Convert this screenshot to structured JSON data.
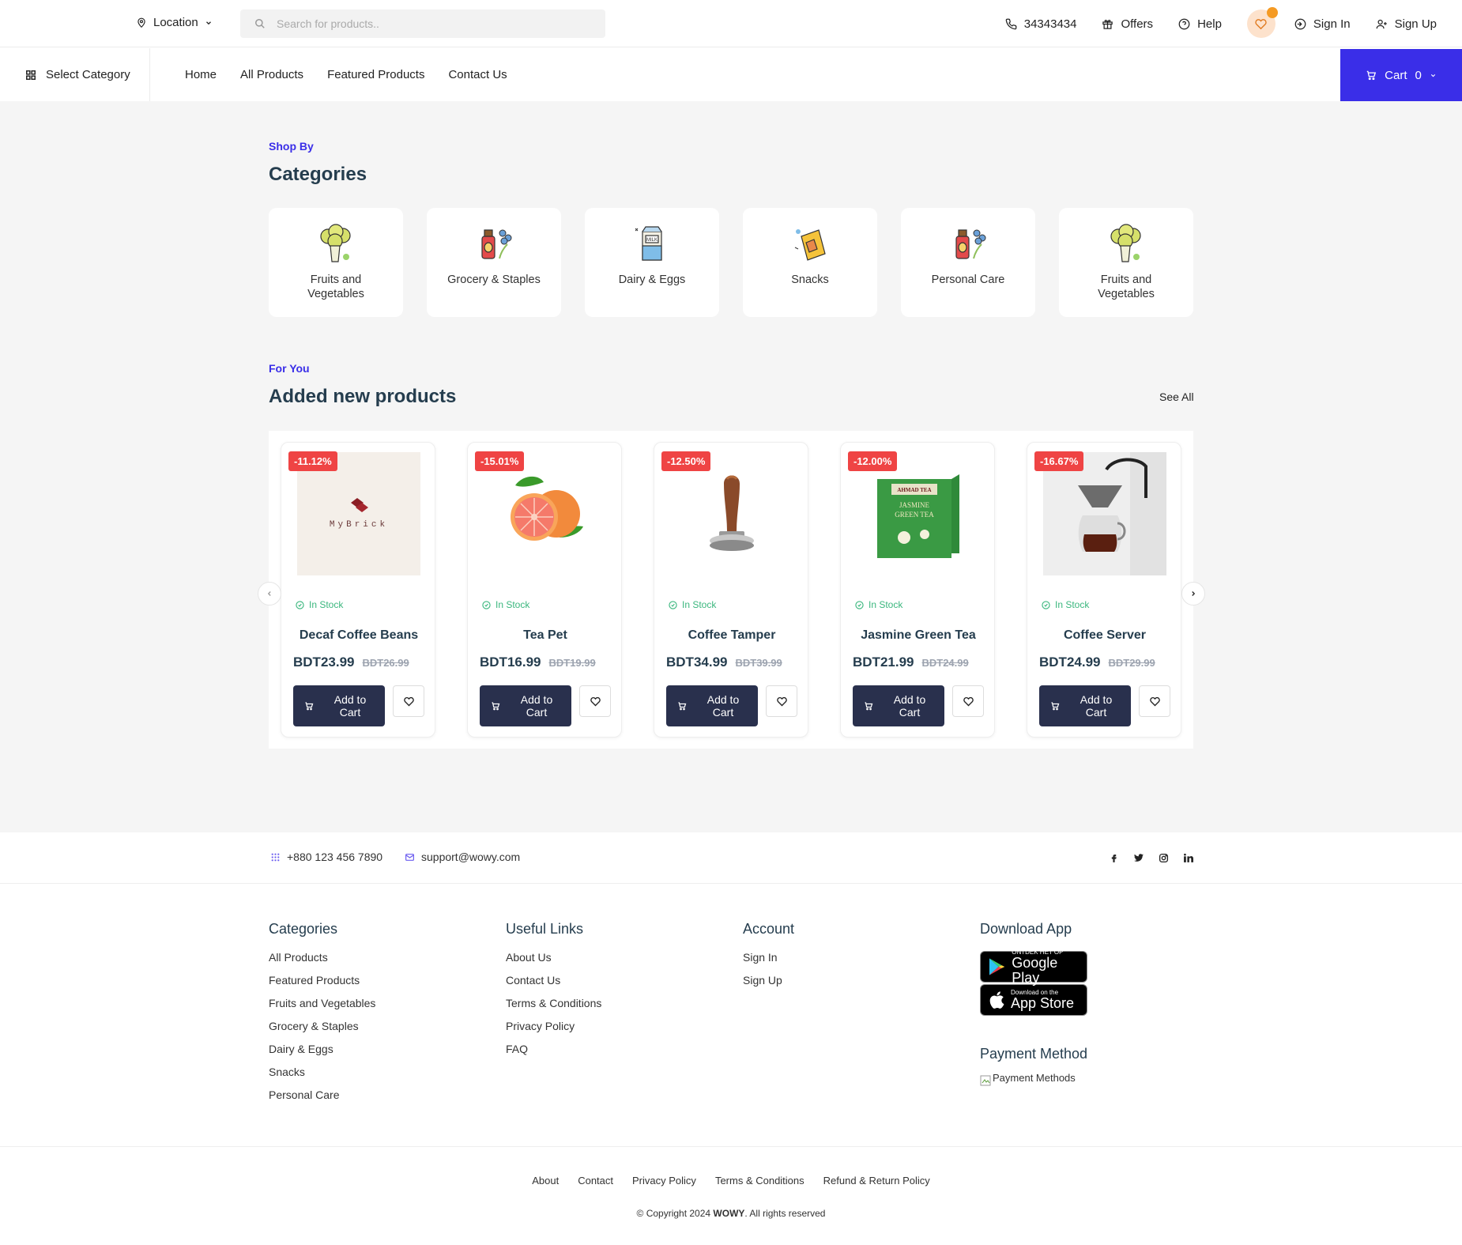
{
  "header": {
    "location_label": "Location",
    "search_placeholder": "Search for products..",
    "phone": "34343434",
    "offers": "Offers",
    "help": "Help",
    "sign_in": "Sign In",
    "sign_up": "Sign Up"
  },
  "nav": {
    "select_category": "Select Category",
    "links": [
      "Home",
      "All Products",
      "Featured Products",
      "Contact Us"
    ],
    "cart_label": "Cart",
    "cart_count": "0"
  },
  "categories_section": {
    "subtitle": "Shop By",
    "title": "Categories",
    "items": [
      {
        "label": "Fruits and Vegetables",
        "icon": "broccoli-icon"
      },
      {
        "label": "Grocery & Staples",
        "icon": "oil-bottle-icon"
      },
      {
        "label": "Dairy & Eggs",
        "icon": "milk-carton-icon"
      },
      {
        "label": "Snacks",
        "icon": "snack-bag-icon"
      },
      {
        "label": "Personal Care",
        "icon": "oil-bottle-icon"
      },
      {
        "label": "Fruits and Vegetables",
        "icon": "broccoli-icon"
      }
    ]
  },
  "products_section": {
    "subtitle": "For You",
    "title": "Added new products",
    "see_all": "See All",
    "stock_label": "In Stock",
    "add_to_cart": "Add to Cart",
    "items": [
      {
        "name": "Decaf Coffee Beans",
        "discount": "-11.12%",
        "price": "BDT23.99",
        "old_price": "BDT26.99",
        "image": "mybrick-logo"
      },
      {
        "name": "Tea Pet",
        "discount": "-15.01%",
        "price": "BDT16.99",
        "old_price": "BDT19.99",
        "image": "grapefruit"
      },
      {
        "name": "Coffee Tamper",
        "discount": "-12.50%",
        "price": "BDT34.99",
        "old_price": "BDT39.99",
        "image": "coffee-tamper"
      },
      {
        "name": "Jasmine Green Tea",
        "discount": "-12.00%",
        "price": "BDT21.99",
        "old_price": "BDT24.99",
        "image": "green-tea-box"
      },
      {
        "name": "Coffee Server",
        "discount": "-16.67%",
        "price": "BDT24.99",
        "old_price": "BDT29.99",
        "image": "coffee-server"
      }
    ]
  },
  "product_images": {
    "brick_text": "MyBrick",
    "tea_brand": "AHMAD TEA",
    "tea_line1": "JASMINE",
    "tea_line2": "GREEN TEA"
  },
  "footer_bar": {
    "phone": "+880 123 456 7890",
    "email": "support@wowy.com"
  },
  "footer": {
    "categories_title": "Categories",
    "categories": [
      "All Products",
      "Featured Products",
      "Fruits and Vegetables",
      "Grocery & Staples",
      "Dairy & Eggs",
      "Snacks",
      "Personal Care"
    ],
    "useful_title": "Useful Links",
    "useful": [
      "About Us",
      "Contact Us",
      "Terms & Conditions",
      "Privacy Policy",
      "FAQ"
    ],
    "account_title": "Account",
    "account": [
      "Sign In",
      "Sign Up"
    ],
    "download_title": "Download App",
    "google_small": "ONTDEK HET OP",
    "google_big": "Google Play",
    "apple_small": "Download on the",
    "apple_big": "App Store",
    "payment_title": "Payment Method",
    "payment_alt": "Payment Methods"
  },
  "bottom": {
    "links": [
      "About",
      "Contact",
      "Privacy Policy",
      "Terms & Conditions",
      "Refund & Return Policy"
    ],
    "copyright_prefix": "© Copyright 2024 ",
    "brand": "WOWY",
    "copyright_suffix": ". All rights reserved"
  },
  "colors": {
    "accent": "#3a2ee8",
    "badge": "#ef4444",
    "stock": "#3bb77e",
    "button": "#29304d",
    "wish_bg": "#fde2cc",
    "wish_dot": "#f59a23"
  }
}
